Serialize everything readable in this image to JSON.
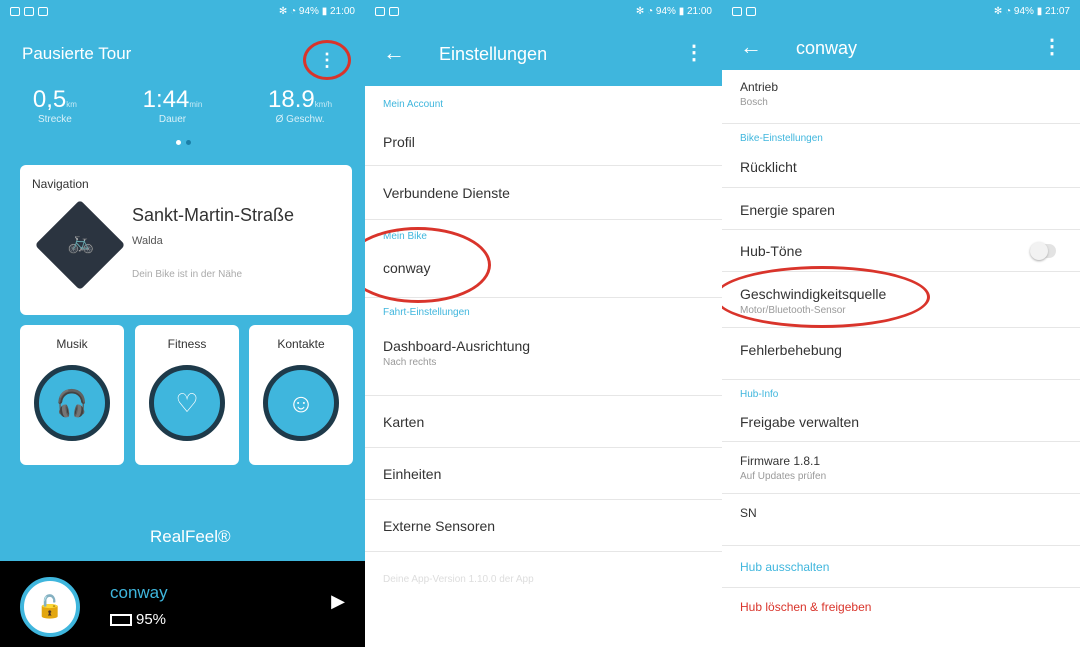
{
  "panel1": {
    "status": {
      "right": "✻ ◔ 94% ▮ 21:00"
    },
    "title": "Pausierte Tour",
    "menu_glyph": "⋮",
    "stats": [
      {
        "value": "0,5",
        "unit": "km",
        "label": "Strecke"
      },
      {
        "value": "1:44",
        "unit": "min",
        "label": "Dauer"
      },
      {
        "value": "18.9",
        "unit": "km/h",
        "label": "Ø Geschw."
      }
    ],
    "nav": {
      "title": "Navigation",
      "street": "Sankt-Martin-Straße",
      "city": "Walda",
      "note": "Dein Bike ist in der Nähe"
    },
    "tiles": [
      {
        "label": "Musik",
        "icon": "headphones-icon"
      },
      {
        "label": "Fitness",
        "icon": "heart-icon"
      },
      {
        "label": "Kontakte",
        "icon": "face-icon"
      }
    ],
    "weather": {
      "label": "RealFeel®"
    },
    "bike": {
      "name": "conway",
      "battery": "95%"
    }
  },
  "panel2": {
    "status": {
      "right": "✻ ◔ 94% ▮ 21:00"
    },
    "title": "Einstellungen",
    "sections": [
      {
        "header": "Mein Account",
        "rows": [
          {
            "label": "Profil"
          },
          {
            "label": "Verbundene Dienste"
          }
        ]
      },
      {
        "header": "Mein Bike",
        "rows": [
          {
            "label": "conway"
          }
        ]
      },
      {
        "header": "Fahrt-Einstellungen",
        "rows": [
          {
            "label": "Dashboard-Ausrichtung",
            "sub": "Nach rechts"
          },
          {
            "label": "Karten"
          },
          {
            "label": "Einheiten"
          },
          {
            "label": "Externe Sensoren"
          },
          {
            "label": "Deine App-Version 1.10.0 der App"
          }
        ]
      }
    ]
  },
  "panel3": {
    "status": {
      "right": "✻ ◔ 94% ▮ 21:07"
    },
    "title": "conway",
    "rows": [
      {
        "label": "Antrieb",
        "sub": "Bosch"
      },
      {
        "header": "Bike-Einstellungen"
      },
      {
        "label": "Rücklicht"
      },
      {
        "label": "Energie sparen"
      },
      {
        "label": "Hub-Töne",
        "toggle": false
      },
      {
        "label": "Geschwindigkeitsquelle",
        "sub": "Motor/Bluetooth-Sensor"
      },
      {
        "label": "Fehlerbehebung"
      },
      {
        "header": "Hub-Info"
      },
      {
        "label": "Freigabe verwalten"
      },
      {
        "label": "Firmware 1.8.1",
        "sub": "Auf Updates prüfen"
      },
      {
        "label": "SN"
      },
      {
        "label": "Hub ausschalten",
        "style": "blue"
      },
      {
        "label": "Hub löschen & freigeben",
        "style": "red"
      }
    ]
  }
}
